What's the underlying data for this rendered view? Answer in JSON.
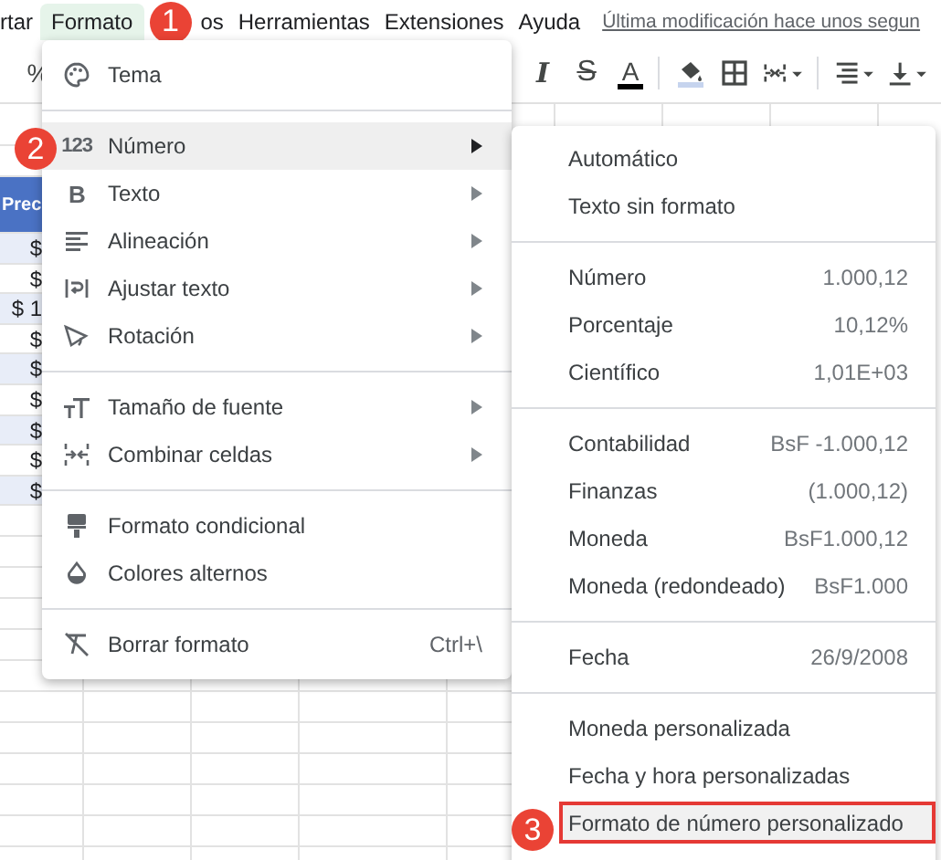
{
  "menubar": {
    "items": [
      {
        "label": "rtar",
        "selected": false
      },
      {
        "label": "Formato",
        "selected": true
      },
      {
        "label": "os",
        "selected": false
      },
      {
        "label": "Herramientas",
        "selected": false
      },
      {
        "label": "Extensiones",
        "selected": false
      },
      {
        "label": "Ayuda",
        "selected": false
      }
    ],
    "last_edit_link": "Última modificación hace unos segun"
  },
  "toolbar": {
    "items": [
      {
        "kind": "glyph",
        "label": "%"
      },
      {
        "kind": "italic",
        "label": "I"
      },
      {
        "kind": "strike",
        "label": "S"
      },
      {
        "kind": "text-color",
        "label": "A"
      },
      {
        "kind": "fill"
      },
      {
        "kind": "borders"
      },
      {
        "kind": "merge"
      },
      {
        "kind": "align"
      },
      {
        "kind": "valign"
      }
    ]
  },
  "sheet": {
    "header": "Prec",
    "cells": [
      "$",
      "$",
      "$ 1",
      "$",
      "$",
      "$",
      "$",
      "$",
      "$"
    ]
  },
  "format_menu": {
    "groups": [
      [
        {
          "label": "Tema",
          "submenu": false,
          "selected": false
        }
      ],
      [
        {
          "label": "Número",
          "glyph": "123",
          "submenu": true,
          "selected": true
        },
        {
          "label": "Texto",
          "glyph": "B",
          "submenu": true,
          "selected": false
        },
        {
          "label": "Alineación",
          "submenu": true,
          "selected": false
        },
        {
          "label": "Ajustar texto",
          "submenu": true,
          "selected": false
        },
        {
          "label": "Rotación",
          "submenu": true,
          "selected": false
        }
      ],
      [
        {
          "label": "Tamaño de fuente",
          "submenu": true,
          "selected": false
        },
        {
          "label": "Combinar celdas",
          "submenu": true,
          "selected": false
        }
      ],
      [
        {
          "label": "Formato condicional",
          "submenu": false,
          "selected": false
        },
        {
          "label": "Colores alternos",
          "submenu": false,
          "selected": false
        }
      ],
      [
        {
          "label": "Borrar formato",
          "shortcut": "Ctrl+\\",
          "submenu": false,
          "selected": false
        }
      ]
    ]
  },
  "number_menu": {
    "groups": [
      [
        {
          "label": "Automático",
          "selected": false,
          "outlined": false
        },
        {
          "label": "Texto sin formato",
          "selected": false,
          "outlined": false
        }
      ],
      [
        {
          "label": "Número",
          "value": "1.000,12",
          "selected": false,
          "outlined": false
        },
        {
          "label": "Porcentaje",
          "value": "10,12%",
          "selected": false,
          "outlined": false
        },
        {
          "label": "Científico",
          "value": "1,01E+03",
          "selected": false,
          "outlined": false
        }
      ],
      [
        {
          "label": "Contabilidad",
          "value": "BsF -1.000,12",
          "selected": false,
          "outlined": false
        },
        {
          "label": "Finanzas",
          "value": "(1.000,12)",
          "selected": false,
          "outlined": false
        },
        {
          "label": "Moneda",
          "value": "BsF1.000,12",
          "selected": false,
          "outlined": false
        },
        {
          "label": "Moneda (redondeado)",
          "value": "BsF1.000",
          "selected": false,
          "outlined": false
        }
      ],
      [
        {
          "label": "Fecha",
          "value": "26/9/2008",
          "selected": false,
          "outlined": false
        }
      ],
      [
        {
          "label": "Moneda personalizada",
          "selected": false,
          "outlined": false
        },
        {
          "label": "Fecha y hora personalizadas",
          "selected": false,
          "outlined": false
        },
        {
          "label": "Formato de número personalizado",
          "selected": true,
          "outlined": true
        }
      ]
    ]
  },
  "step_badges": [
    "1",
    "2",
    "3"
  ]
}
